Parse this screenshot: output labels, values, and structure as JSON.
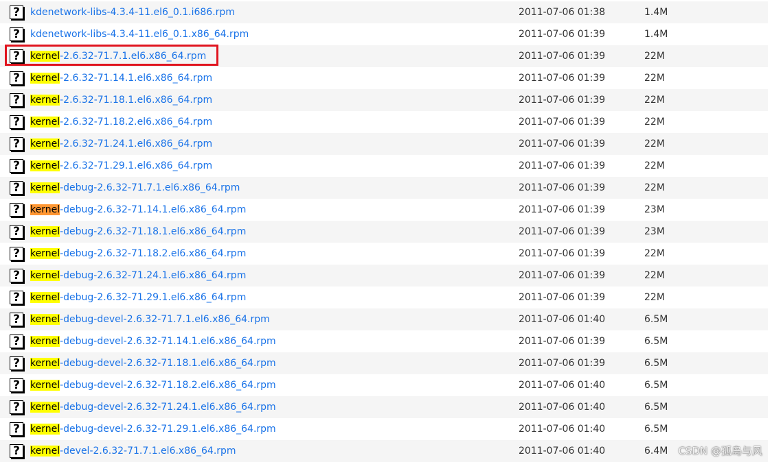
{
  "highlight_term": "kernel",
  "colors": {
    "link": "#1a73e8",
    "search_highlight": "#ffff00",
    "current_match": "#ff9632",
    "annotation_box": "#e0141e",
    "row_alt": "#f5f5f5"
  },
  "file_icon": "unknown-file-icon",
  "files": [
    {
      "name": "kdenetwork-libs-4.3.4-11.el6_0.1.i686.rpm",
      "date": "2011-07-06 01:38",
      "size": "1.4M",
      "match": ""
    },
    {
      "name": "kdenetwork-libs-4.3.4-11.el6_0.1.x86_64.rpm",
      "date": "2011-07-06 01:39",
      "size": "1.4M",
      "match": ""
    },
    {
      "name": "kernel-2.6.32-71.7.1.el6.x86_64.rpm",
      "date": "2011-07-06 01:39",
      "size": "22M",
      "match": "kernel"
    },
    {
      "name": "kernel-2.6.32-71.14.1.el6.x86_64.rpm",
      "date": "2011-07-06 01:39",
      "size": "22M",
      "match": "kernel"
    },
    {
      "name": "kernel-2.6.32-71.18.1.el6.x86_64.rpm",
      "date": "2011-07-06 01:39",
      "size": "22M",
      "match": "kernel"
    },
    {
      "name": "kernel-2.6.32-71.18.2.el6.x86_64.rpm",
      "date": "2011-07-06 01:39",
      "size": "22M",
      "match": "kernel"
    },
    {
      "name": "kernel-2.6.32-71.24.1.el6.x86_64.rpm",
      "date": "2011-07-06 01:39",
      "size": "22M",
      "match": "kernel"
    },
    {
      "name": "kernel-2.6.32-71.29.1.el6.x86_64.rpm",
      "date": "2011-07-06 01:39",
      "size": "22M",
      "match": "kernel"
    },
    {
      "name": "kernel-debug-2.6.32-71.7.1.el6.x86_64.rpm",
      "date": "2011-07-06 01:39",
      "size": "22M",
      "match": "kernel"
    },
    {
      "name": "kernel-debug-2.6.32-71.14.1.el6.x86_64.rpm",
      "date": "2011-07-06 01:39",
      "size": "23M",
      "match": "kernel",
      "current": true
    },
    {
      "name": "kernel-debug-2.6.32-71.18.1.el6.x86_64.rpm",
      "date": "2011-07-06 01:39",
      "size": "23M",
      "match": "kernel"
    },
    {
      "name": "kernel-debug-2.6.32-71.18.2.el6.x86_64.rpm",
      "date": "2011-07-06 01:39",
      "size": "22M",
      "match": "kernel"
    },
    {
      "name": "kernel-debug-2.6.32-71.24.1.el6.x86_64.rpm",
      "date": "2011-07-06 01:39",
      "size": "22M",
      "match": "kernel"
    },
    {
      "name": "kernel-debug-2.6.32-71.29.1.el6.x86_64.rpm",
      "date": "2011-07-06 01:39",
      "size": "22M",
      "match": "kernel"
    },
    {
      "name": "kernel-debug-devel-2.6.32-71.7.1.el6.x86_64.rpm",
      "date": "2011-07-06 01:40",
      "size": "6.5M",
      "match": "kernel"
    },
    {
      "name": "kernel-debug-devel-2.6.32-71.14.1.el6.x86_64.rpm",
      "date": "2011-07-06 01:39",
      "size": "6.5M",
      "match": "kernel"
    },
    {
      "name": "kernel-debug-devel-2.6.32-71.18.1.el6.x86_64.rpm",
      "date": "2011-07-06 01:39",
      "size": "6.5M",
      "match": "kernel"
    },
    {
      "name": "kernel-debug-devel-2.6.32-71.18.2.el6.x86_64.rpm",
      "date": "2011-07-06 01:40",
      "size": "6.5M",
      "match": "kernel"
    },
    {
      "name": "kernel-debug-devel-2.6.32-71.24.1.el6.x86_64.rpm",
      "date": "2011-07-06 01:40",
      "size": "6.5M",
      "match": "kernel"
    },
    {
      "name": "kernel-debug-devel-2.6.32-71.29.1.el6.x86_64.rpm",
      "date": "2011-07-06 01:40",
      "size": "6.5M",
      "match": "kernel"
    },
    {
      "name": "kernel-devel-2.6.32-71.7.1.el6.x86_64.rpm",
      "date": "2011-07-06 01:40",
      "size": "6.4M",
      "match": "kernel"
    }
  ],
  "watermark": "CSDN @孤岛与风"
}
